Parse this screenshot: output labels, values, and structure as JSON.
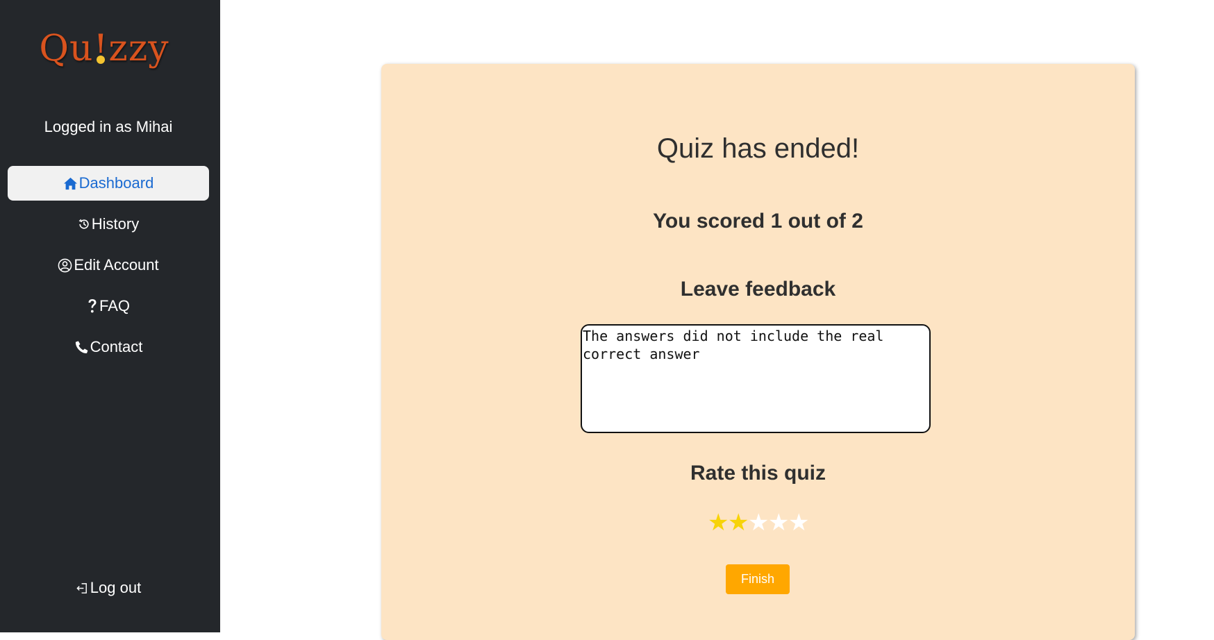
{
  "app": {
    "logo_prefix": "Qu",
    "logo_bang": "!",
    "logo_suffix": "zzy",
    "brand_color": "#d9531e"
  },
  "sidebar": {
    "user_label": "Logged in as Mihai",
    "items": [
      {
        "label": "Dashboard",
        "icon": "home-icon",
        "active": true
      },
      {
        "label": "History",
        "icon": "history-icon",
        "active": false
      },
      {
        "label": "Edit Account",
        "icon": "user-circle-icon",
        "active": false
      },
      {
        "label": "FAQ",
        "icon": "question-icon",
        "active": false
      },
      {
        "label": "Contact",
        "icon": "phone-icon",
        "active": false
      }
    ],
    "logout_label": "Log out",
    "logout_icon": "logout-icon"
  },
  "result": {
    "title": "Quiz has ended!",
    "score_text": "You scored 1 out of 2",
    "feedback_heading": "Leave feedback",
    "feedback_value": "The answers did not include the real correct answer",
    "rate_heading": "Rate this quiz",
    "rating": 2,
    "rating_max": 5,
    "finish_label": "Finish"
  },
  "colors": {
    "card_bg": "#fde4c4",
    "sidebar_bg": "#24272b",
    "active_link": "#1a6ad1",
    "star_on": "#f7d308",
    "finish_button": "#ffa700"
  }
}
